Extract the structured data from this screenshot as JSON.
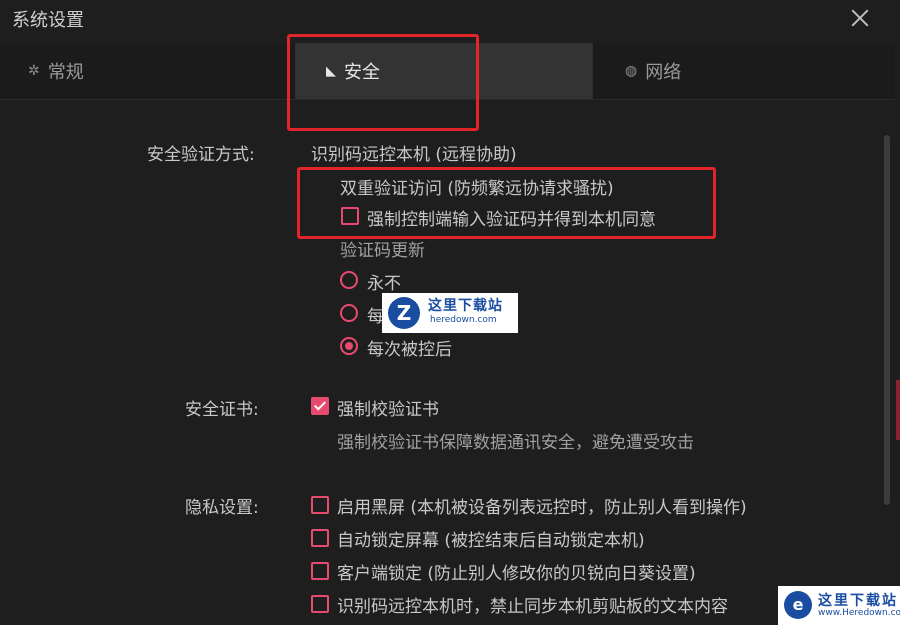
{
  "window": {
    "title": "系统设置"
  },
  "tabs": [
    {
      "label": "常规",
      "icon": "gear-icon"
    },
    {
      "label": "安全",
      "icon": "security-icon"
    },
    {
      "label": "网络",
      "icon": "globe-icon"
    }
  ],
  "security_verification": {
    "label": "安全验证方式:",
    "mode": "识别码远控本机 (远程协助)",
    "two_factor_label": "双重验证访问 (防频繁远协请求骚扰)",
    "force_code_checkbox": {
      "label": "强制控制端输入验证码并得到本机同意",
      "checked": false
    },
    "code_update_label": "验证码更新",
    "code_update_options": [
      {
        "label": "永不",
        "selected": false
      },
      {
        "label": "每",
        "selected": false
      },
      {
        "label": "每次被控后",
        "selected": true
      }
    ]
  },
  "certificate": {
    "label": "安全证书:",
    "checkbox": {
      "label": "强制校验证书",
      "checked": true
    },
    "description": "强制校验证书保障数据通讯安全，避免遭受攻击"
  },
  "privacy": {
    "label": "隐私设置:",
    "options": [
      {
        "label": "启用黑屏 (本机被设备列表远控时，防止别人看到操作)",
        "checked": false
      },
      {
        "label": "自动锁定屏幕 (被控结束后自动锁定本机)",
        "checked": false
      },
      {
        "label": "客户端锁定 (防止别人修改你的贝锐向日葵设置)",
        "checked": false
      },
      {
        "label": "识别码远控本机时，禁止同步本机剪贴板的文本内容",
        "checked": false
      }
    ]
  },
  "watermarks": [
    {
      "logo": "Z",
      "text": "这里下载站",
      "url": "heredown.com"
    },
    {
      "logo": "e",
      "text": "这里下载站",
      "url": "www.Heredown.com"
    }
  ],
  "colors": {
    "accent": "#e84a6f",
    "highlight": "#e0262b",
    "background": "#1e1e1e"
  }
}
